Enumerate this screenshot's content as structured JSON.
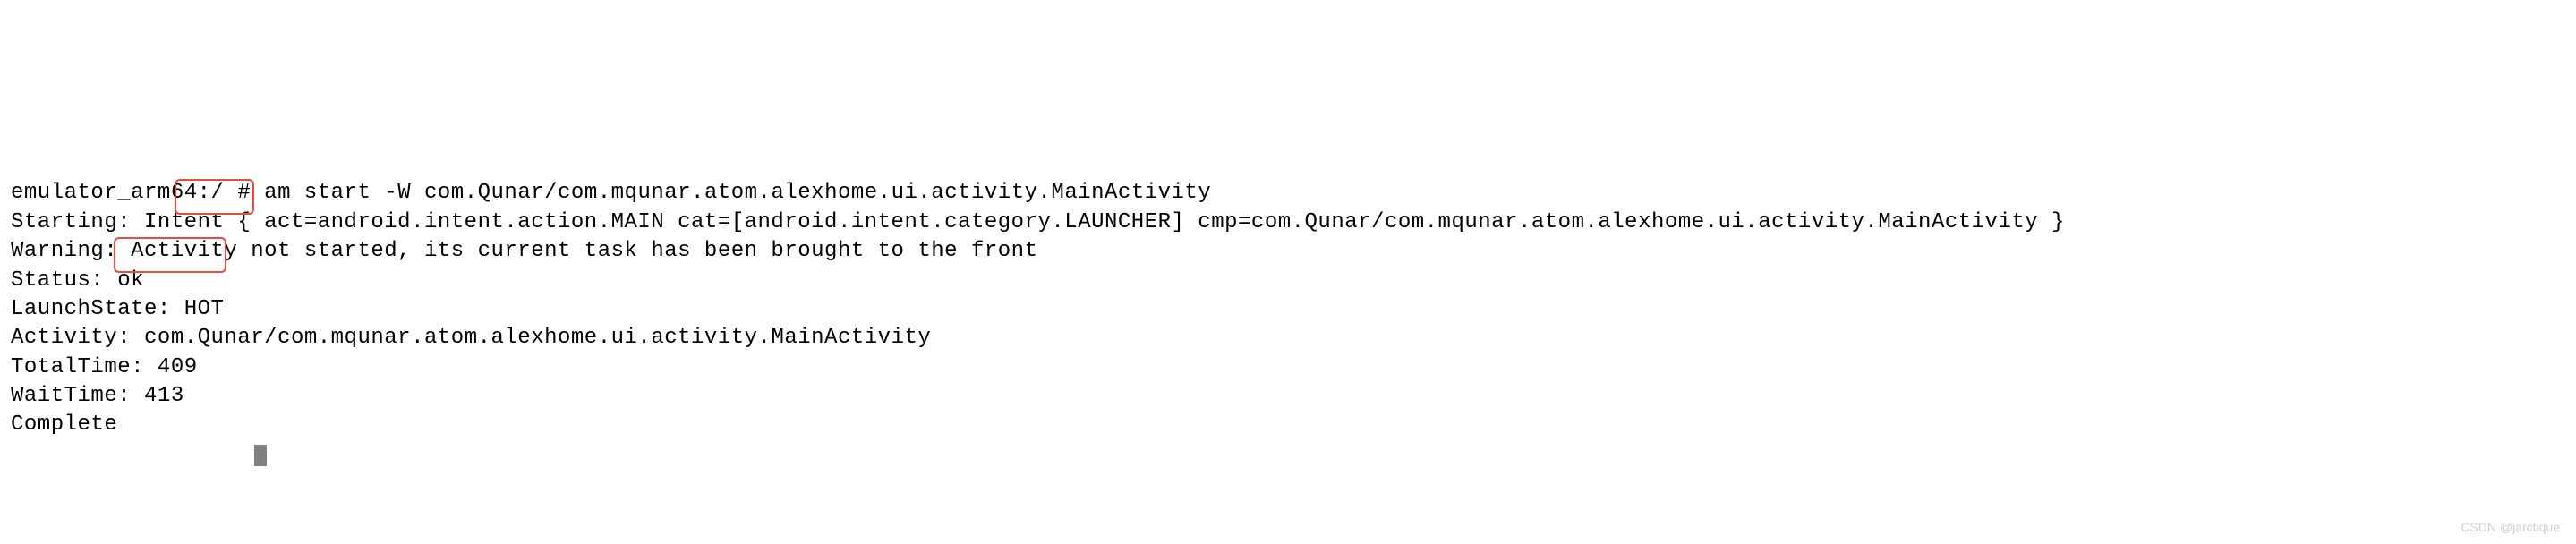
{
  "terminal": {
    "prompt_host": "emulator_arm64",
    "prompt_path": ":/",
    "prompt_symbol": " # ",
    "command": "am start -W com.Qunar/com.mqunar.atom.alexhome.ui.activity.MainActivity",
    "starting_line": "Starting: Intent { act=android.intent.action.MAIN cat=[android.intent.category.LAUNCHER] cmp=com.Qunar/com.mqunar.atom.alexhome.ui.activity.MainActivity }",
    "warning_line": "Warning: Activity not started, its current task has been brought to the front",
    "status_label": "Status: ",
    "status_value": "ok",
    "launchstate_label": "LaunchState:",
    "launchstate_value": " HOT",
    "activity_label": "Activity: ",
    "activity_value": "com.Qunar/com.mqunar.atom.alexhome.ui.activity.MainActivity",
    "totaltime_label": "TotalTim",
    "totaltime_label2": "e: 409",
    "waittime_label": "WaitTime: ",
    "waittime_value": "413",
    "complete_label": "Complete"
  },
  "watermark": "CSDN @jarctique"
}
